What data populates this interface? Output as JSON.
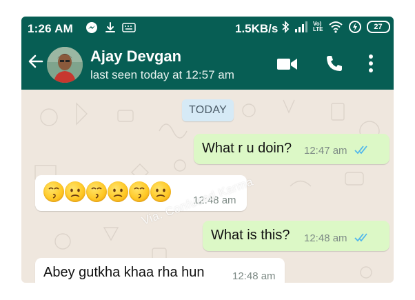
{
  "status_bar": {
    "time": "1:26 AM",
    "net_speed": "1.5KB/s",
    "lte_top": "Vo)",
    "lte_bottom": "LTE",
    "battery": "27",
    "icons": [
      "messenger-icon",
      "download-icon",
      "keyboard-icon",
      "bluetooth-icon",
      "signal-icon",
      "volte-icon",
      "wifi-icon",
      "data-saver-icon",
      "battery-icon"
    ]
  },
  "header": {
    "contact_name": "Ajay Devgan",
    "last_seen": "last seen today at 12:57 am",
    "icons": [
      "back-arrow-icon",
      "avatar",
      "video-call-icon",
      "phone-icon",
      "more-icon"
    ]
  },
  "chat": {
    "date_chip": "TODAY",
    "messages": [
      {
        "direction": "out",
        "text": "What r u doin?",
        "time": "12:47 am",
        "status": "read"
      },
      {
        "direction": "in",
        "text": "",
        "emojis": [
          "kissing",
          "confused",
          "kissing",
          "confused",
          "kissing",
          "confused"
        ],
        "time": "12:48 am"
      },
      {
        "direction": "out",
        "text": "What is this?",
        "time": "12:48 am",
        "status": "read"
      },
      {
        "direction": "in",
        "text": "Abey gutkha khaa rha hun",
        "time": "12:48 am"
      }
    ],
    "watermark": "Via. Confused Karma"
  },
  "colors": {
    "header": "#075e54",
    "outgoing_bubble": "#dcf8c6",
    "incoming_bubble": "#ffffff",
    "chat_bg": "#efe7de",
    "read_ticks": "#4fb6ec"
  }
}
